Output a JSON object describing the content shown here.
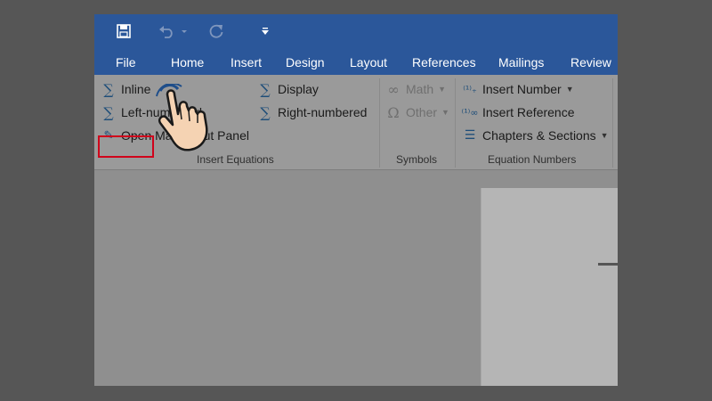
{
  "quick_access": {
    "icons": [
      "save-icon",
      "undo-icon",
      "redo-icon",
      "customize-toolbar-icon"
    ]
  },
  "tabs": [
    "File",
    "Home",
    "Insert",
    "Design",
    "Layout",
    "References",
    "Mailings",
    "Review"
  ],
  "ribbon": {
    "insert_equations": {
      "inline": "Inline",
      "left_numbered": "Left-numbered",
      "open_math_input_panel": "Open Math Input Panel",
      "display": "Display",
      "right_numbered": "Right-numbered",
      "group_label": "Insert Equations"
    },
    "symbols": {
      "math": "Math",
      "other": "Other",
      "group_label": "Symbols"
    },
    "equation_numbers": {
      "insert_number": "Insert Number",
      "insert_reference": "Insert Reference",
      "chapters_sections": "Chapters & Sections",
      "group_label": "Equation Numbers"
    }
  },
  "colors": {
    "title_bar": "#2b579a",
    "highlight_border": "#d0021b",
    "icon_accent": "#1f4e79"
  }
}
